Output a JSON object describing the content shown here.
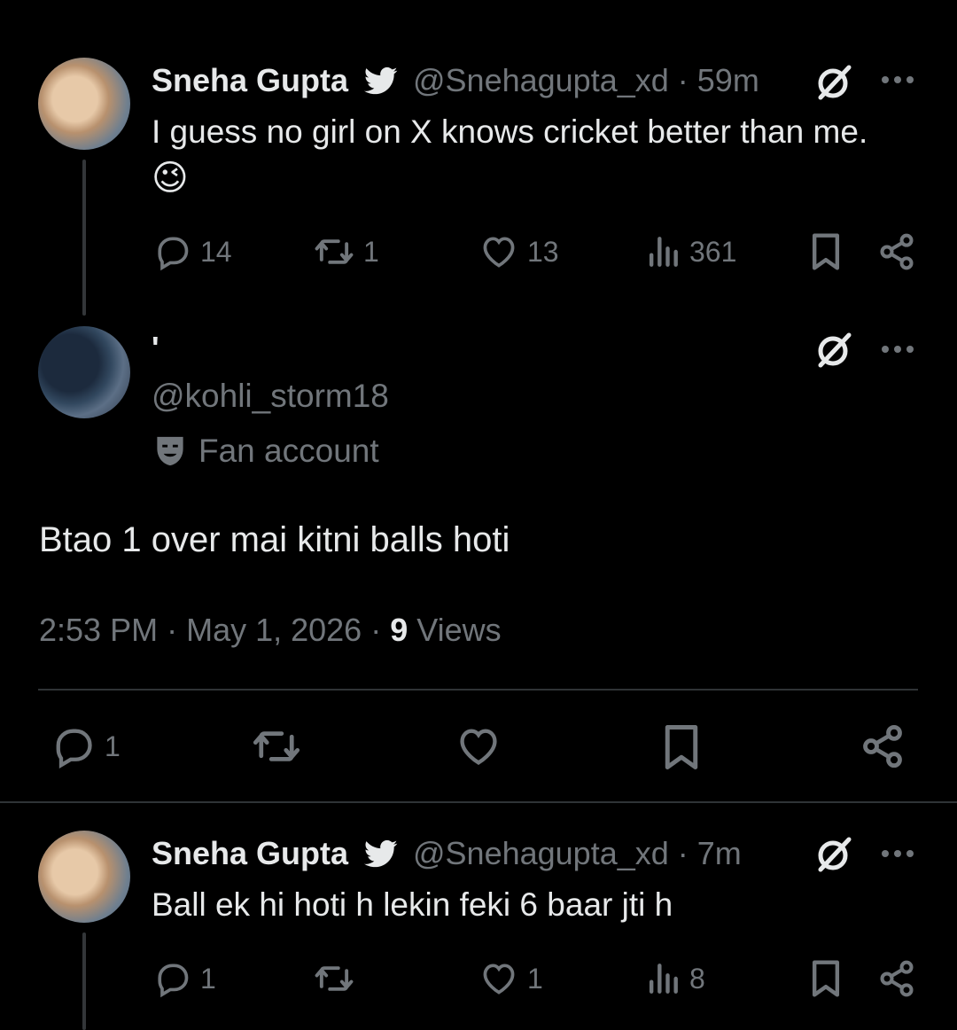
{
  "tweet1": {
    "name": "Sneha Gupta",
    "handle": "@Snehagupta_xd",
    "time": "59m",
    "text": "I guess no girl on X knows cricket better than me.",
    "emoji": "😉",
    "replies": "14",
    "retweets": "1",
    "likes": "13",
    "views": "361"
  },
  "main": {
    "name": "'",
    "handle": "@kohli_storm18",
    "label": "Fan account",
    "text": "Btao 1 over mai kitni balls hoti",
    "time": "2:53 PM",
    "date": "May 1, 2026",
    "views_count": "9",
    "views_label": "Views",
    "replies": "1"
  },
  "reply": {
    "name": "Sneha Gupta",
    "handle": "@Snehagupta_xd",
    "time": "7m",
    "text": "Ball ek hi hoti h lekin feki 6 baar jti h",
    "replies": "1",
    "likes": "1",
    "views": "8"
  },
  "colors": {
    "bg": "#000000",
    "text": "#e7e9ea",
    "muted": "#71767b",
    "divider": "#2f3336"
  }
}
